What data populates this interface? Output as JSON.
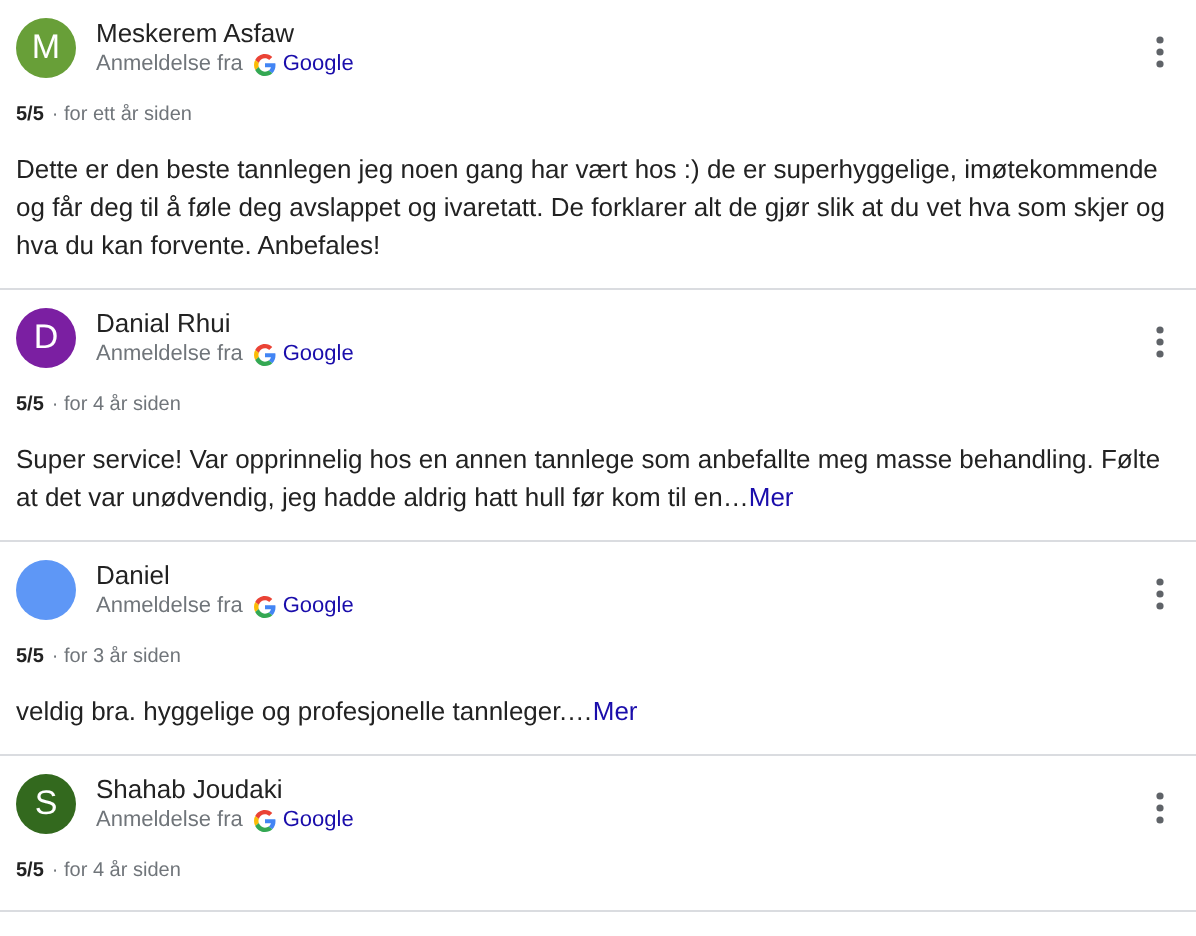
{
  "reviews": [
    {
      "avatar_letter": "M",
      "color": "#689f38",
      "name": "Meskerem Asfaw",
      "source_label": "Anmeldelse fra",
      "source": "Google",
      "rating": "5/5",
      "time": "· for ett år siden",
      "text": "Dette er den beste tannlegen jeg noen gang har vært hos :) de er superhyggelige, imøtekommende og får deg til å føle deg avslappet og ivaretatt. De forklarer alt de gjør slik at du vet hva som skjer og hva du kan forvente. Anbefales!"
    },
    {
      "avatar_letter": "D",
      "color": "#7b1fa2",
      "name": "Danial Rhui",
      "source_label": "Anmeldelse fra",
      "source": "Google",
      "rating": "5/5",
      "time": "· for 4 år siden",
      "text": "Super service! Var opprinnelig hos en annen tannlege som anbefallte meg masse behandling. Følte at det var unødvendig, jeg hadde aldrig hatt hull før kom til en…",
      "more": "Mer"
    },
    {
      "color": "#5e97f6",
      "name": "Daniel",
      "source_label": "Anmeldelse fra",
      "source": "Google",
      "rating": "5/5",
      "time": "· for 3 år siden",
      "text": "veldig bra. hyggelige og profesjonelle tannleger.…",
      "more": "Mer"
    },
    {
      "avatar_letter": "S",
      "color": "#33691e",
      "name": "Shahab Joudaki",
      "source_label": "Anmeldelse fra",
      "source": "Google",
      "rating": "5/5",
      "time": "· for 4 år siden"
    }
  ]
}
